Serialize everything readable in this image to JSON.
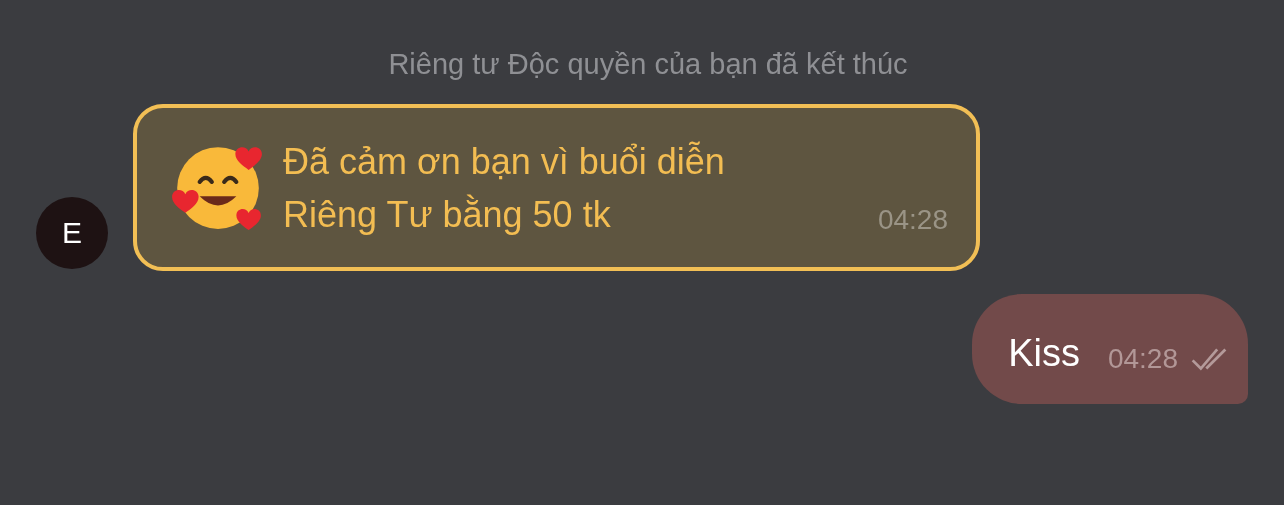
{
  "messages": [
    {
      "kind": "system",
      "text": "Riêng tư Độc quyền của bạn đã kết thúc"
    },
    {
      "kind": "incoming",
      "avatar": "E",
      "highlighted": true,
      "lines": [
        "Đã cảm ơn bạn vì buổi diễn",
        "Riêng Tư bằng 50 tk"
      ],
      "time": "04:28"
    },
    {
      "kind": "outgoing",
      "text": "Kiss",
      "time": "04:28",
      "read": true
    }
  ]
}
